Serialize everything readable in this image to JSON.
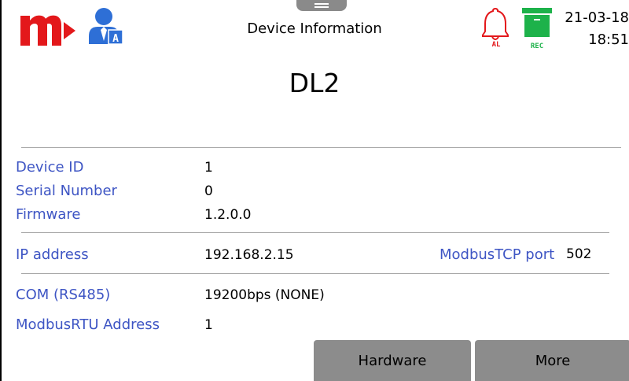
{
  "header": {
    "title": "Device Information",
    "date": "21-03-18",
    "time": "18:51",
    "user_badge": "A",
    "alarm_badge": "AL",
    "rec_badge": "REC"
  },
  "device": {
    "name": "DL2"
  },
  "info": {
    "device_id_label": "Device ID",
    "device_id": "1",
    "serial_label": "Serial Number",
    "serial": "0",
    "firmware_label": "Firmware",
    "firmware": "1.2.0.0",
    "ip_label": "IP address",
    "ip": "192.168.2.15",
    "port_label": "ModbusTCP port",
    "port": "502",
    "com_label": "COM (RS485)",
    "com": "19200bps (NONE)",
    "rtu_label": "ModbusRTU Address",
    "rtu": "1"
  },
  "buttons": {
    "hardware": "Hardware",
    "more": "More"
  },
  "colors": {
    "brand_red": "#e3181b",
    "user_blue": "#2e6fd6",
    "alarm_red": "#e3181b",
    "rec_green": "#1db24a",
    "label_blue": "#3e55c4",
    "button_gray": "#8c8c8c"
  },
  "icons": {
    "logo": "brand-logo",
    "user": "user-icon",
    "alarm": "bell-icon",
    "rec": "archive-icon",
    "menu": "menu-handle-icon"
  }
}
